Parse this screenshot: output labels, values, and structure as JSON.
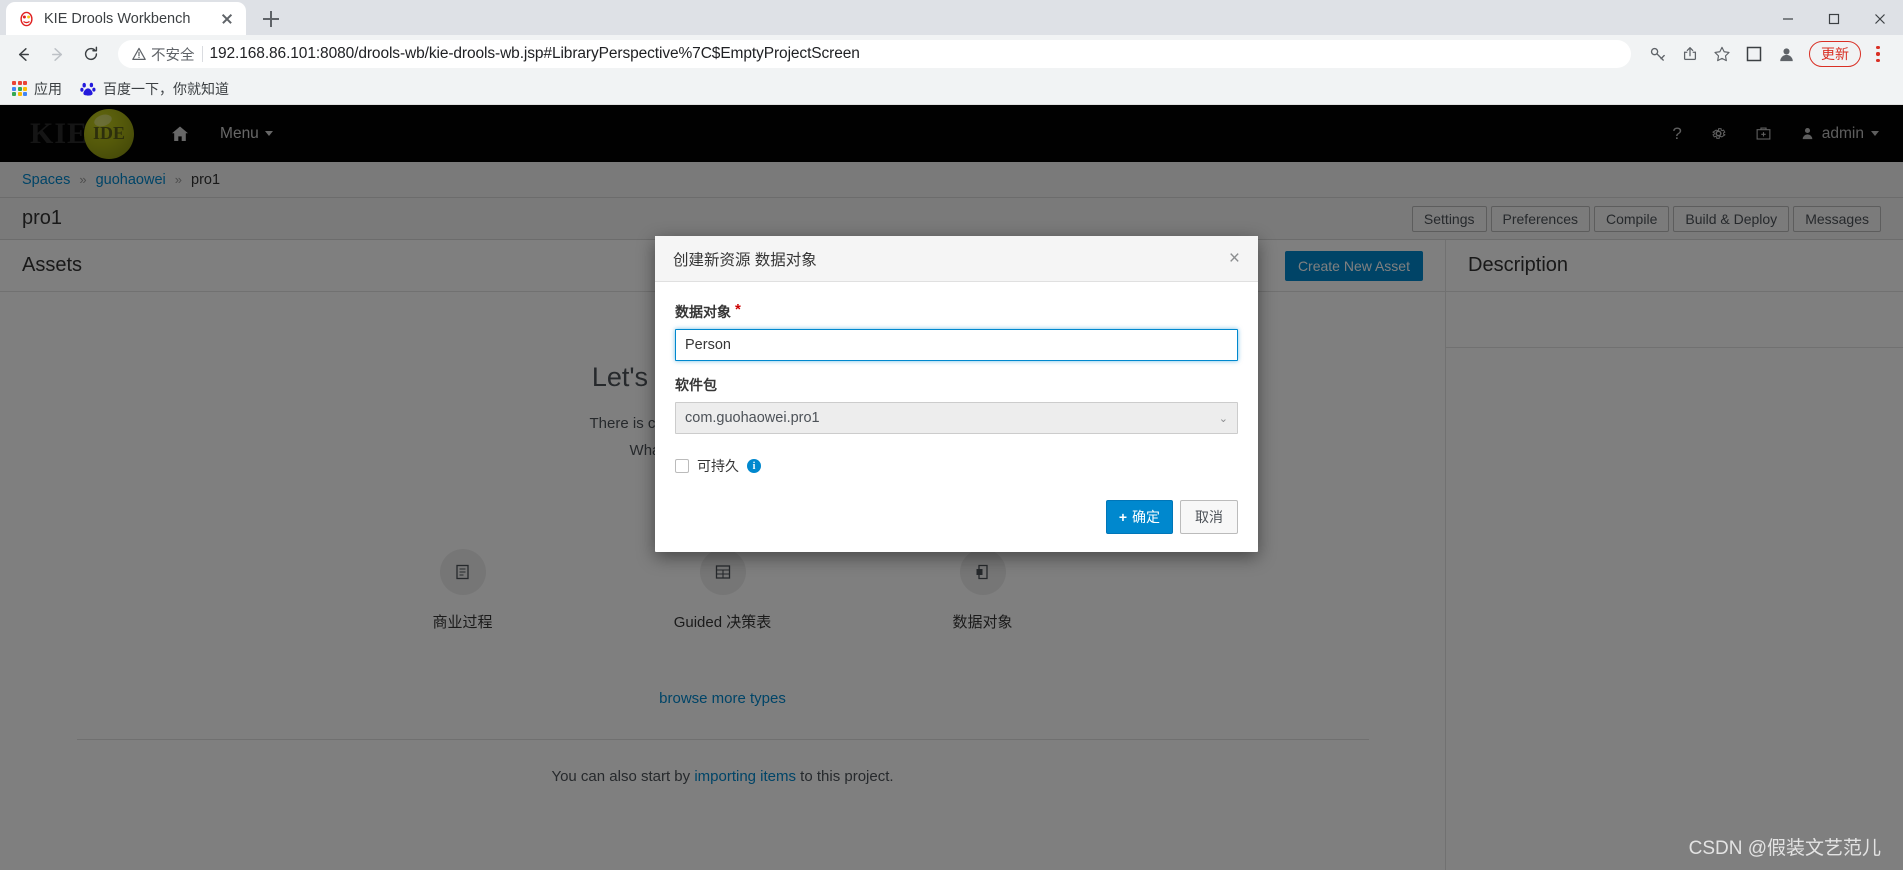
{
  "browser": {
    "tab": {
      "title": "KIE Drools Workbench",
      "favicon": "drools-favicon"
    },
    "new_tab_label": "+",
    "nav": {
      "back": "back-arrow",
      "forward": "forward-arrow",
      "reload": "reload-arrow"
    },
    "omnibox": {
      "security_label": "不安全",
      "url_host": "192.168.86.101:8080",
      "url_path": "/drools-wb/kie-drools-wb.jsp#LibraryPerspective%7C$EmptyProjectScreen",
      "url_full": "192.168.86.101:8080/drools-wb/kie-drools-wb.jsp#LibraryPerspective%7C$EmptyProjectScreen"
    },
    "toolbar_icons": [
      "key-icon",
      "share-icon",
      "star-icon",
      "sidebar-icon",
      "profile-icon"
    ],
    "update_button": "更新",
    "bookmarks": [
      {
        "label": "应用",
        "icon": "apps-grid-icon"
      },
      {
        "label": "百度一下，你就知道",
        "icon": "baidu-icon"
      }
    ],
    "window_controls": [
      "minimize",
      "maximize",
      "close"
    ]
  },
  "app": {
    "logo": {
      "text": "KIE",
      "ball_text": "IDE"
    },
    "nav": {
      "home_icon": "home-icon",
      "menu_label": "Menu",
      "help_icon": "question-icon",
      "settings_icon": "gear-icon",
      "toolkit_icon": "briefcase-icon",
      "user_label": "admin"
    },
    "breadcrumb": {
      "items": [
        "Spaces",
        "guohaowei",
        "pro1"
      ],
      "separator": "»"
    },
    "project": {
      "title": "pro1",
      "actions": [
        "Settings",
        "Preferences",
        "Compile",
        "Build & Deploy",
        "Messages"
      ]
    },
    "assets": {
      "title": "Assets",
      "create_button": "Create New Asset",
      "empty_headline": "Let's make some stuff",
      "empty_line1": "There is currently nothing in this project.",
      "empty_line2": "What do you want to make?",
      "tiles": [
        {
          "label": "商业过程",
          "icon": "business-process-icon"
        },
        {
          "label": "Guided 决策表",
          "icon": "decision-table-icon"
        },
        {
          "label": "数据对象",
          "icon": "data-object-icon"
        }
      ],
      "browse_more": "browse more types",
      "import_prefix": "You can also start by ",
      "import_link": "importing items",
      "import_suffix": " to this project."
    },
    "description_panel": {
      "title": "Description"
    }
  },
  "modal": {
    "title": "创建新资源 数据对象",
    "close_label": "×",
    "name_field": {
      "label": "数据对象",
      "required_marker": "*",
      "value": "Person",
      "placeholder": ""
    },
    "package_field": {
      "label": "软件包",
      "value": "com.guohaowei.pro1",
      "options": [
        "com.guohaowei.pro1"
      ]
    },
    "persistable": {
      "label": "可持久",
      "checked": false,
      "info_icon": "info-icon"
    },
    "buttons": {
      "ok": "确定",
      "ok_prefix": "+",
      "cancel": "取消"
    }
  },
  "watermark": "CSDN @假装文艺范儿",
  "colors": {
    "accent_blue": "#0088ce",
    "navbar_black": "#030303",
    "logo_green": "#a8b115",
    "required_red": "#c00",
    "update_red": "#d93025"
  }
}
